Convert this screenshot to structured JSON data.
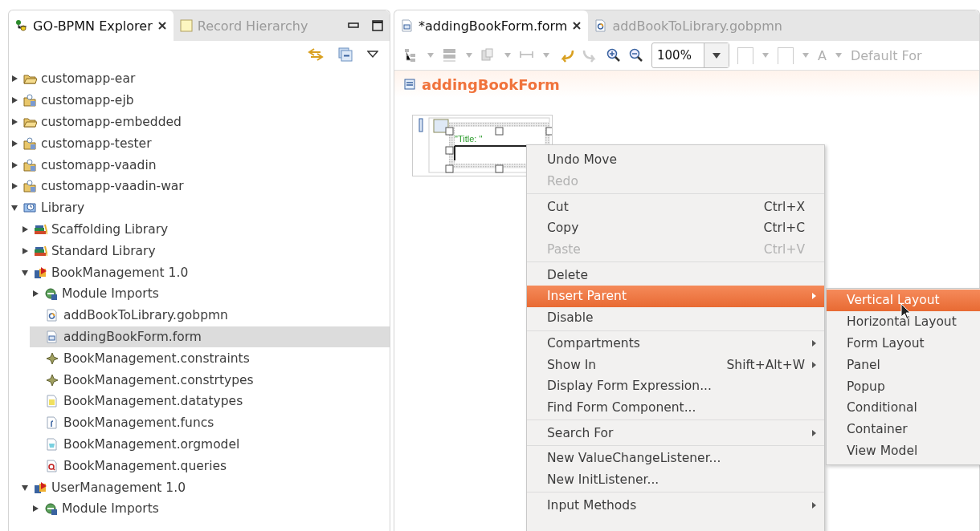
{
  "explorer": {
    "tabs": [
      {
        "label": "GO-BPMN Explorer",
        "selected": true,
        "closable": true
      },
      {
        "label": "Record Hierarchy",
        "selected": false,
        "closable": false
      }
    ],
    "tree": [
      {
        "label": "customapp-ear",
        "kind": "folder",
        "expanded": false,
        "selected": false
      },
      {
        "label": "customapp-ejb",
        "kind": "project",
        "expanded": false,
        "selected": false
      },
      {
        "label": "customapp-embedded",
        "kind": "folder",
        "expanded": false,
        "selected": false
      },
      {
        "label": "customapp-tester",
        "kind": "project",
        "expanded": false,
        "selected": false
      },
      {
        "label": "customapp-vaadin",
        "kind": "project",
        "expanded": false,
        "selected": false
      },
      {
        "label": "customapp-vaadin-war",
        "kind": "project",
        "expanded": false,
        "selected": false
      },
      {
        "label": "Library",
        "kind": "library",
        "expanded": true,
        "selected": false,
        "children": [
          {
            "label": "Scaffolding Library",
            "kind": "books",
            "expanded": false,
            "selected": false
          },
          {
            "label": "Standard Library",
            "kind": "books",
            "expanded": false,
            "selected": false
          },
          {
            "label": "BookManagement 1.0",
            "kind": "module",
            "expanded": true,
            "selected": false,
            "children": [
              {
                "label": "Module Imports",
                "kind": "imports",
                "expanded": false,
                "selected": false
              },
              {
                "label": "addBookToLibrary.gobpmn",
                "kind": "process",
                "selected": false
              },
              {
                "label": "addingBookForm.form",
                "kind": "form",
                "selected": true
              },
              {
                "label": "BookManagement.constraints",
                "kind": "constraint",
                "selected": false
              },
              {
                "label": "BookManagement.constrtypes",
                "kind": "constraint",
                "selected": false
              },
              {
                "label": "BookManagement.datatypes",
                "kind": "datatypes",
                "selected": false
              },
              {
                "label": "BookManagement.funcs",
                "kind": "funcs",
                "selected": false
              },
              {
                "label": "BookManagement.orgmodel",
                "kind": "orgmodel",
                "selected": false
              },
              {
                "label": "BookManagement.queries",
                "kind": "queries",
                "selected": false
              }
            ]
          },
          {
            "label": "UserManagement 1.0",
            "kind": "module",
            "expanded": true,
            "selected": false,
            "children": [
              {
                "label": "Module Imports",
                "kind": "imports",
                "expanded": false,
                "selected": false
              }
            ]
          }
        ]
      }
    ]
  },
  "editor": {
    "tabs": [
      {
        "label": "*addingBookForm.form",
        "selected": true,
        "closable": true
      },
      {
        "label": "addBookToLibrary.gobpmn",
        "selected": false,
        "closable": false
      }
    ],
    "zoom": "100%",
    "font_text": "A",
    "font_name": "Default For",
    "form_title": "addingBookForm",
    "canvas": {
      "label_text": "\"Title: \""
    }
  },
  "context_menu": {
    "groups": [
      [
        {
          "label": "Undo Move",
          "disabled": false,
          "selected": false
        },
        {
          "label": "Redo",
          "disabled": true,
          "selected": false
        }
      ],
      [
        {
          "label": "Cut",
          "shortcut": "Ctrl+X",
          "disabled": false,
          "selected": false
        },
        {
          "label": "Copy",
          "shortcut": "Ctrl+C",
          "disabled": false,
          "selected": false
        },
        {
          "label": "Paste",
          "shortcut": "Ctrl+V",
          "disabled": true,
          "selected": false
        }
      ],
      [
        {
          "label": "Delete",
          "disabled": false,
          "selected": false
        },
        {
          "label": "Insert Parent",
          "disabled": false,
          "selected": true,
          "submenu": true
        },
        {
          "label": "Disable",
          "disabled": false,
          "selected": false
        }
      ],
      [
        {
          "label": "Compartments",
          "disabled": false,
          "selected": false,
          "submenu": true
        },
        {
          "label": "Show In",
          "shortcut": "Shift+Alt+W",
          "disabled": false,
          "selected": false,
          "submenu": true
        },
        {
          "label": "Display Form Expression...",
          "disabled": false,
          "selected": false
        },
        {
          "label": "Find Form Component...",
          "disabled": false,
          "selected": false
        }
      ],
      [
        {
          "label": "Search For",
          "disabled": false,
          "selected": false,
          "submenu": true
        }
      ],
      [
        {
          "label": "New ValueChangeListener...",
          "disabled": false,
          "selected": false
        },
        {
          "label": "New InitListener...",
          "disabled": false,
          "selected": false
        }
      ],
      [
        {
          "label": "Input Methods",
          "disabled": false,
          "selected": false,
          "submenu": true
        }
      ]
    ],
    "submenu": [
      {
        "label": "Vertical Layout",
        "selected": true
      },
      {
        "label": "Horizontal Layout",
        "selected": false
      },
      {
        "label": "Form Layout",
        "selected": false
      },
      {
        "label": "Panel",
        "selected": false
      },
      {
        "label": "Popup",
        "selected": false
      },
      {
        "label": "Conditional",
        "selected": false
      },
      {
        "label": "Container",
        "selected": false
      },
      {
        "label": "View Model",
        "selected": false
      }
    ]
  }
}
